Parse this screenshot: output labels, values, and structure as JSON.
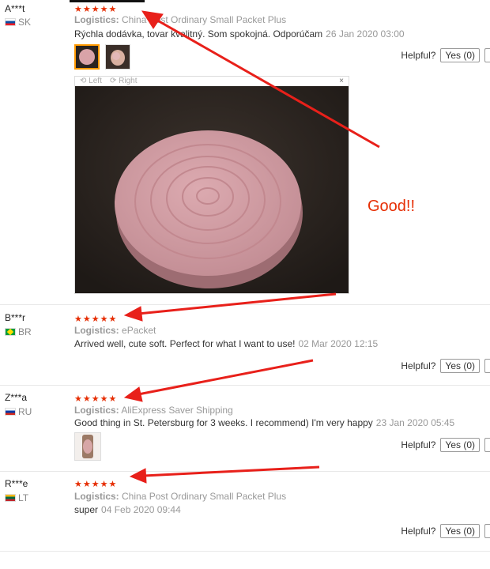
{
  "reviews": [
    {
      "user": "A***t",
      "country": "SK",
      "stars": "★★★★★",
      "logistics_label": "Logistics:",
      "logistics": "China Post Ordinary Small Packet Plus",
      "text": "Rýchla dodávka, tovar kvalitný. Som spokojná. Odporúčam",
      "date": "26 Jan 2020 03:00",
      "helpful": "Helpful?",
      "yes": "Yes (0)"
    },
    {
      "user": "B***r",
      "country": "BR",
      "stars": "★★★★★",
      "logistics_label": "Logistics:",
      "logistics": "ePacket",
      "text": "Arrived well, cute soft. Perfect for what I want to use!",
      "date": "02 Mar 2020 12:15",
      "helpful": "Helpful?",
      "yes": "Yes (0)"
    },
    {
      "user": "Z***a",
      "country": "RU",
      "stars": "★★★★★",
      "logistics_label": "Logistics:",
      "logistics": "AliExpress Saver Shipping",
      "text": "Good thing in St. Petersburg for 3 weeks. I recommend) I'm very happy",
      "date": "23 Jan 2020 05:45",
      "helpful": "Helpful?",
      "yes": "Yes (0)"
    },
    {
      "user": "R***e",
      "country": "LT",
      "stars": "★★★★★",
      "logistics_label": "Logistics:",
      "logistics": "China Post Ordinary Small Packet Plus",
      "text": "super",
      "date": "04 Feb 2020 09:44",
      "helpful": "Helpful?",
      "yes": "Yes (0)"
    }
  ],
  "viewer": {
    "left": "Left",
    "right": "Right",
    "close": "×"
  },
  "annotation": {
    "text": "Good!!",
    "color": "#e62e04"
  },
  "colors": {
    "star": "#e62e04",
    "arrow": "#e8201a",
    "thumb_active": "#ff9900"
  }
}
